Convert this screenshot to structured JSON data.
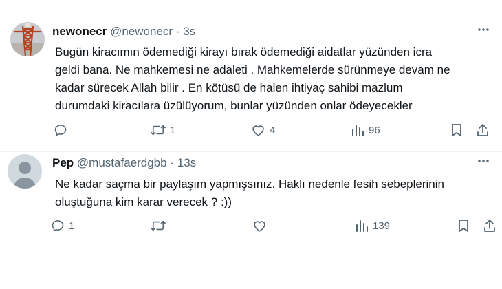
{
  "tweets": [
    {
      "name": "newonecr",
      "handle": "@newonecr",
      "separator": "·",
      "time": "3s",
      "lines": [
        "Bugün kiracımın ödemediği kirayı bırak ödemediği aidatlar yüzünden icra",
        "geldi bana. Ne mahkemesi ne adaleti . Mahkemelerde sürünmeye devam ne",
        "kadar sürecek Allah bilir . En kötüsü de halen ihtiyaç sahibi mazlum",
        "durumdaki kiracılara üzülüyorum, bunlar yüzünden onlar ödeyecekler"
      ],
      "replies": "",
      "reposts": "1",
      "likes": "4",
      "views": "96"
    },
    {
      "name": "Pep",
      "handle": "@mustafaerdgbb",
      "separator": "·",
      "time": "13s",
      "lines": [
        "Ne kadar saçma bir paylaşım yapmışsınız. Haklı nedenle fesih sebeplerinin",
        "oluştuğuna kim karar verecek ? :))"
      ],
      "replies": "1",
      "reposts": "",
      "likes": "",
      "views": "139"
    }
  ],
  "icons": {
    "more": "more-icon",
    "reply": "reply-icon",
    "repost": "repost-icon",
    "like": "heart-icon",
    "views": "views-icon",
    "bookmark": "bookmark-icon",
    "share": "share-icon"
  },
  "colors": {
    "icon_gray": "#536471",
    "text": "#0f1419",
    "divider": "#eff3f4",
    "default_avatar_bg": "#cfd9de"
  }
}
